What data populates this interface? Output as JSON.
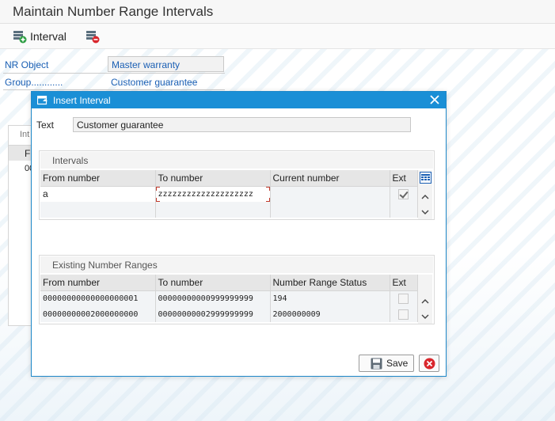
{
  "page": {
    "title": "Maintain Number Range Intervals"
  },
  "toolbar": {
    "interval_label": "Interval",
    "interval_icon": "add-interval-icon",
    "delete_icon": "delete-interval-icon"
  },
  "header_fields": {
    "nr_object_label": "NR Object",
    "nr_object_value": "Master warranty",
    "group_label": "Group............",
    "group_value": "Customer guarantee"
  },
  "background_panel": {
    "tab_fragment": "Int",
    "col_fragment": "F",
    "cell_fragment": "00"
  },
  "dialog": {
    "title": "Insert Interval",
    "title_icon": "dialog-icon",
    "close_icon": "close-icon",
    "text_label": "Text",
    "text_value": "Customer guarantee",
    "intervals": {
      "title": "Intervals",
      "columns": [
        "From number",
        "To number",
        "Current number",
        "Ext"
      ],
      "config_icon": "table-settings-icon",
      "rows": [
        {
          "from": "a",
          "to": "zzzzzzzzzzzzzzzzzzzz",
          "current": "",
          "ext_checked": true
        },
        {
          "from": "",
          "to": "",
          "current": "",
          "ext_checked": false
        }
      ]
    },
    "existing": {
      "title": "Existing Number Ranges",
      "columns": [
        "From number",
        "To number",
        "Number Range Status",
        "Ext"
      ],
      "rows": [
        {
          "from": "00000000000000000001",
          "to": "00000000000999999999",
          "status": "194",
          "ext_checked": false
        },
        {
          "from": "00000000002000000000",
          "to": "00000000002999999999",
          "status": "2000000009",
          "ext_checked": false
        }
      ]
    },
    "save_label": "Save",
    "save_icon": "save-icon",
    "cancel_icon": "cancel-icon"
  },
  "colors": {
    "accent": "#1a8fd6",
    "link_blue": "#1a5fb4",
    "cancel_red": "#d9262c"
  }
}
